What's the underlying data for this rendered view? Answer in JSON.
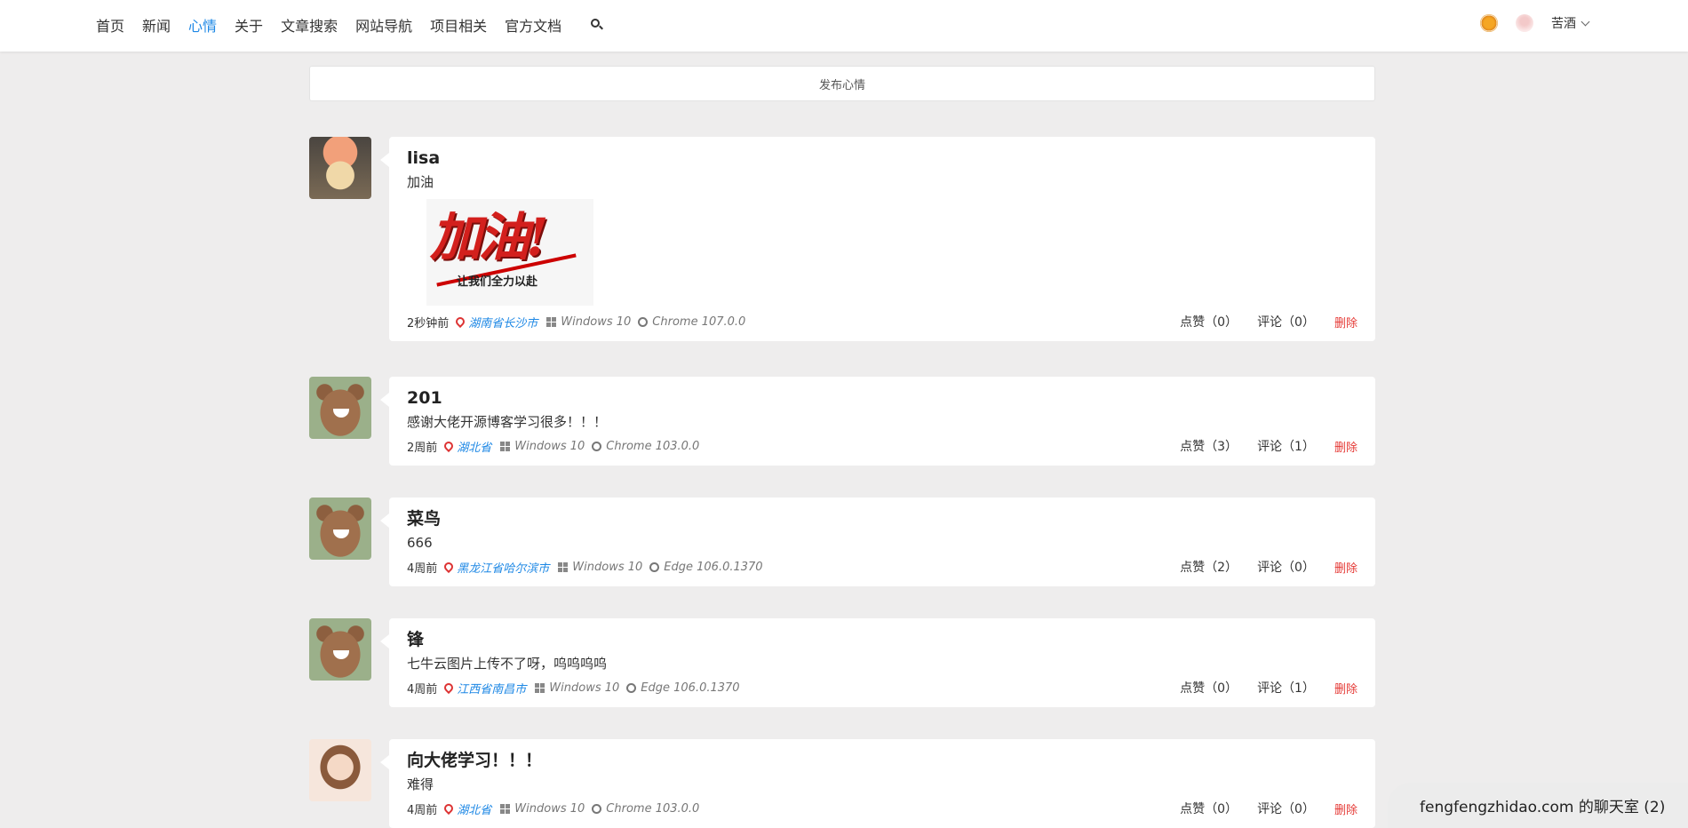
{
  "nav": {
    "items": [
      "首页",
      "新闻",
      "心情",
      "关于",
      "文章搜索",
      "网站导航",
      "项目相关",
      "官方文档"
    ],
    "active_index": 2
  },
  "user": {
    "name": "苦酒"
  },
  "publish": {
    "label": "发布心情"
  },
  "posts": [
    {
      "name": "lisa",
      "text": "加油",
      "image": {
        "main_text": "加油!",
        "sub_text": "让我们全力以赴"
      },
      "time": "2秒钟前",
      "location": "湖南省长沙市",
      "os": "Windows 10",
      "browser": "Chrome 107.0.0",
      "likes": "点赞（0）",
      "comments": "评论（0）",
      "delete": "删除"
    },
    {
      "name": "201",
      "text": "感谢大佬开源博客学习很多！！！",
      "time": "2周前",
      "location": "湖北省",
      "os": "Windows 10",
      "browser": "Chrome 103.0.0",
      "likes": "点赞（3）",
      "comments": "评论（1）",
      "delete": "删除"
    },
    {
      "name": "菜鸟",
      "text": "666",
      "time": "4周前",
      "location": "黑龙江省哈尔滨市",
      "os": "Windows 10",
      "browser": "Edge 106.0.1370",
      "likes": "点赞（2）",
      "comments": "评论（0）",
      "delete": "删除"
    },
    {
      "name": "锋",
      "text": "七牛云图片上传不了呀，呜呜呜呜",
      "time": "4周前",
      "location": "江西省南昌市",
      "os": "Windows 10",
      "browser": "Edge 106.0.1370",
      "likes": "点赞（0）",
      "comments": "评论（1）",
      "delete": "删除"
    },
    {
      "name": "向大佬学习！！！",
      "text": "难得",
      "time": "4周前",
      "location": "湖北省",
      "os": "Windows 10",
      "browser": "Chrome 103.0.0",
      "likes": "点赞（0）",
      "comments": "评论（0）",
      "delete": "删除"
    }
  ],
  "chat": {
    "label": "fengfengzhidao.com 的聊天室 (2)"
  },
  "colors": {
    "accent": "#1e88e5",
    "danger": "#e53935",
    "background": "#eeeded"
  }
}
